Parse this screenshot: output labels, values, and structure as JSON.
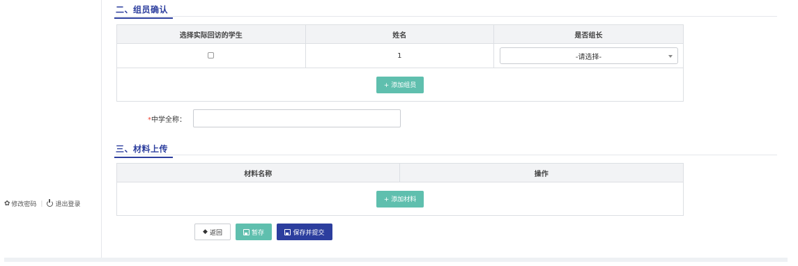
{
  "sidebar": {
    "change_password": "修改密码",
    "separator": "|",
    "logout": "退出登录"
  },
  "section2": {
    "title": "二、组员确认",
    "table": {
      "headers": [
        "选择实际回访的学生",
        "姓名",
        "是否组长"
      ],
      "rows": [
        {
          "checked": false,
          "name": "1",
          "leader_select": "-请选择-"
        }
      ]
    },
    "add_member_label": "+ 添加组员"
  },
  "school_field": {
    "required_mark": "*",
    "label": "中学全称：",
    "value": ""
  },
  "section3": {
    "title": "三、材料上传",
    "table": {
      "headers": [
        "材料名称",
        "操作"
      ]
    },
    "add_material_label": "+ 添加材料"
  },
  "actions": {
    "back_label": "返回",
    "save_label": "暂存",
    "submit_label": "保存并提交"
  }
}
